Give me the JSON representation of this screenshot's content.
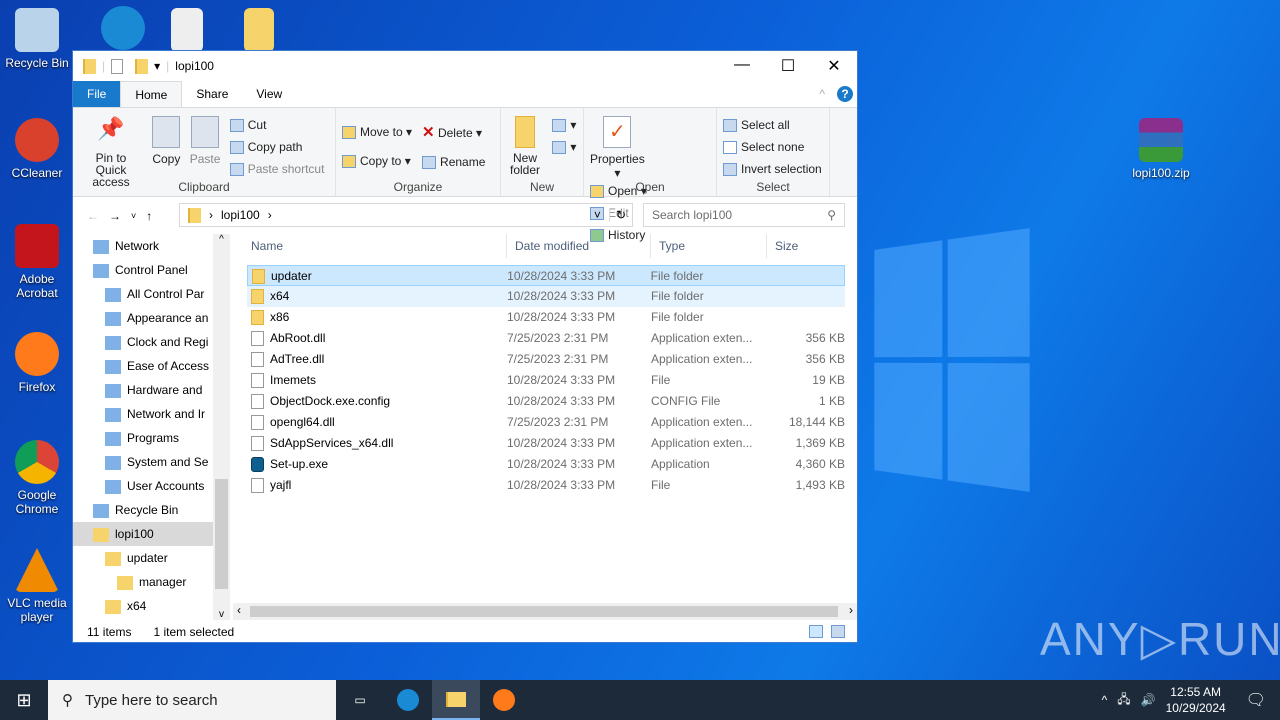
{
  "desktop": {
    "icons": [
      "Recycle Bin",
      "CCleaner",
      "Adobe Acrobat",
      "Firefox",
      "Google Chrome",
      "VLC media player"
    ],
    "right_icon": "lopi100.zip"
  },
  "window": {
    "title": "lopi100",
    "tabs": [
      "File",
      "Home",
      "Share",
      "View"
    ]
  },
  "ribbon": {
    "clipboard": {
      "pin": "Pin to Quick access",
      "copy": "Copy",
      "paste": "Paste",
      "cut": "Cut",
      "copy_path": "Copy path",
      "paste_shortcut": "Paste shortcut",
      "label": "Clipboard"
    },
    "organize": {
      "move_to": "Move to",
      "copy_to": "Copy to",
      "delete": "Delete",
      "rename": "Rename",
      "label": "Organize"
    },
    "new": {
      "new_folder": "New folder",
      "label": "New"
    },
    "open": {
      "properties": "Properties",
      "open": "Open",
      "edit": "Edit",
      "history": "History",
      "label": "Open"
    },
    "select": {
      "select_all": "Select all",
      "select_none": "Select none",
      "invert": "Invert selection",
      "label": "Select"
    }
  },
  "address": {
    "path": "lopi100",
    "search_placeholder": "Search lopi100"
  },
  "nav": [
    "Network",
    "Control Panel",
    "All Control Par",
    "Appearance an",
    "Clock and Regi",
    "Ease of Access",
    "Hardware and",
    "Network and Ir",
    "Programs",
    "System and Se",
    "User Accounts",
    "Recycle Bin",
    "lopi100",
    "updater",
    "manager",
    "x64"
  ],
  "columns": [
    "Name",
    "Date modified",
    "Type",
    "Size"
  ],
  "files": [
    {
      "name": "updater",
      "date": "10/28/2024 3:33 PM",
      "type": "File folder",
      "size": "",
      "icon": "folder"
    },
    {
      "name": "x64",
      "date": "10/28/2024 3:33 PM",
      "type": "File folder",
      "size": "",
      "icon": "folder"
    },
    {
      "name": "x86",
      "date": "10/28/2024 3:33 PM",
      "type": "File folder",
      "size": "",
      "icon": "folder"
    },
    {
      "name": "AbRoot.dll",
      "date": "7/25/2023 2:31 PM",
      "type": "Application exten...",
      "size": "356 KB",
      "icon": "dll"
    },
    {
      "name": "AdTree.dll",
      "date": "7/25/2023 2:31 PM",
      "type": "Application exten...",
      "size": "356 KB",
      "icon": "dll"
    },
    {
      "name": "Imemets",
      "date": "10/28/2024 3:33 PM",
      "type": "File",
      "size": "19 KB",
      "icon": "file"
    },
    {
      "name": "ObjectDock.exe.config",
      "date": "10/28/2024 3:33 PM",
      "type": "CONFIG File",
      "size": "1 KB",
      "icon": "file"
    },
    {
      "name": "opengl64.dll",
      "date": "7/25/2023 2:31 PM",
      "type": "Application exten...",
      "size": "18,144 KB",
      "icon": "dll"
    },
    {
      "name": "SdAppServices_x64.dll",
      "date": "10/28/2024 3:33 PM",
      "type": "Application exten...",
      "size": "1,369 KB",
      "icon": "dll"
    },
    {
      "name": "Set-up.exe",
      "date": "10/28/2024 3:33 PM",
      "type": "Application",
      "size": "4,360 KB",
      "icon": "exe"
    },
    {
      "name": "yajfl",
      "date": "10/28/2024 3:33 PM",
      "type": "File",
      "size": "1,493 KB",
      "icon": "file"
    }
  ],
  "status": {
    "count": "11 items",
    "selected": "1 item selected"
  },
  "taskbar": {
    "search": "Type here to search",
    "time": "12:55 AM",
    "date": "10/29/2024"
  },
  "watermark": "ANY RUN"
}
